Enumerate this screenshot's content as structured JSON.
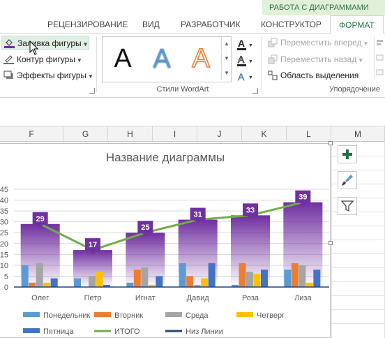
{
  "ribbon_tabs": {
    "context_header": "РАБОТА С ДИАГРАММАМИ",
    "tabs": [
      "РЕЦЕНЗИРОВАНИЕ",
      "ВИД",
      "РАЗРАБОТЧИК",
      "КОНСТРУКТОР",
      "ФОРМАТ"
    ],
    "active": "ФОРМАТ"
  },
  "shape_styles": {
    "fill_label": "Заливка фигуры",
    "outline_label": "Контур фигуры",
    "effects_label": "Эффекты фигуры"
  },
  "wordart": {
    "samples": [
      "A",
      "A",
      "A"
    ],
    "group_label": "Стили WordArt"
  },
  "arrange": {
    "bring_forward": "Переместить вперед",
    "send_backward": "Переместить назад",
    "selection_pane": "Область выделения",
    "group_label": "Упорядочение"
  },
  "columns": [
    "F",
    "G",
    "H",
    "I",
    "J",
    "K",
    "L",
    "M"
  ],
  "colors": {
    "accent": "#217346",
    "mon": "#5b9bd5",
    "tue": "#ed7d31",
    "wed": "#a5a5a5",
    "thu": "#ffc000",
    "fri": "#4472c4",
    "total": "#70ad47",
    "low": "#264478",
    "bar_top": "#7030a0"
  },
  "side_buttons": [
    "plus-icon",
    "brush-icon",
    "filter-icon"
  ],
  "chart_data": {
    "type": "bar",
    "title": "Название диаграммы",
    "categories": [
      "Олег",
      "Петр",
      "Игнат",
      "Давид",
      "Роза",
      "Лиза"
    ],
    "ylim": [
      0,
      45
    ],
    "yticks": [
      0,
      5,
      10,
      15,
      20,
      25,
      30,
      35,
      40,
      45
    ],
    "grid": true,
    "legend_position": "bottom",
    "series": [
      {
        "name": "Понедельник",
        "values": [
          10,
          4,
          2,
          11,
          1,
          8
        ]
      },
      {
        "name": "Вторник",
        "values": [
          2,
          0,
          8,
          5,
          11,
          11
        ]
      },
      {
        "name": "Среда",
        "values": [
          11,
          5,
          9,
          1,
          7,
          10
        ]
      },
      {
        "name": "Четверг",
        "values": [
          2,
          7,
          1,
          4,
          6,
          2
        ]
      },
      {
        "name": "Пятница",
        "values": [
          4,
          1,
          5,
          11,
          8,
          8
        ]
      },
      {
        "name": "ИТОГО",
        "values": [
          29,
          17,
          25,
          31,
          33,
          39
        ]
      },
      {
        "name": "Низ Линии",
        "values": [
          0,
          0,
          0,
          0,
          0,
          0
        ]
      }
    ],
    "data_labels": [
      "29",
      "17",
      "25",
      "31",
      "33",
      "39"
    ]
  }
}
